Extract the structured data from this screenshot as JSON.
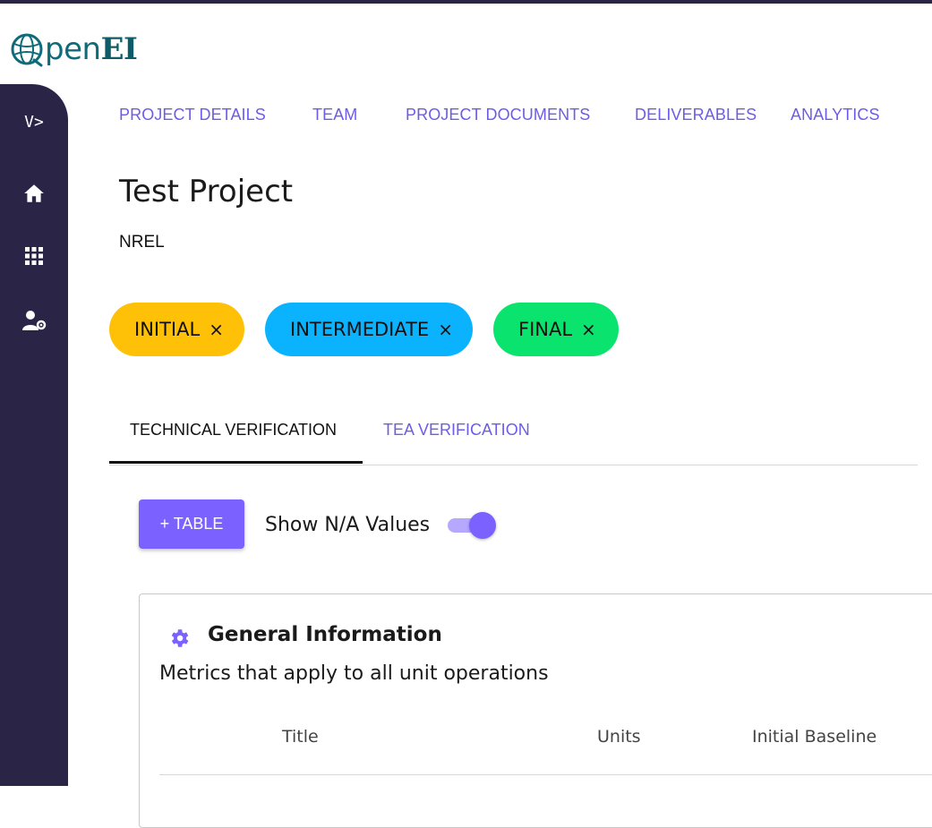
{
  "brand": {
    "logo_text_open": "pen",
    "logo_text_ei": "EI"
  },
  "nav": {
    "items": [
      {
        "label": "PROJECT DETAILS"
      },
      {
        "label": "TEAM"
      },
      {
        "label": "PROJECT DOCUMENTS"
      },
      {
        "label": "DELIVERABLES"
      },
      {
        "label": "ANALYTICS"
      }
    ]
  },
  "sidebar": {
    "toggle_label": "V>",
    "icons": [
      "home-icon",
      "apps-grid-icon",
      "user-settings-icon"
    ]
  },
  "project": {
    "title": "Test Project",
    "organization": "NREL"
  },
  "stages": {
    "items": [
      {
        "label": "INITIAL",
        "remove": "×",
        "color": "#ffc107"
      },
      {
        "label": "INTERMEDIATE",
        "remove": "×",
        "color": "#0bb3ff"
      },
      {
        "label": "FINAL",
        "remove": "×",
        "color": "#0ae36d"
      }
    ]
  },
  "tabs": {
    "items": [
      {
        "label": "TECHNICAL VERIFICATION",
        "active": true
      },
      {
        "label": "TEA VERIFICATION",
        "active": false
      }
    ]
  },
  "toolbar": {
    "add_table_label": "+ TABLE",
    "show_na_label": "Show N/A Values",
    "show_na_on": true
  },
  "card": {
    "title": "General Information",
    "subtitle": "Metrics that apply to all unit operations",
    "icon": "gear-icon",
    "columns": [
      "Title",
      "Units",
      "Initial Baseline"
    ]
  },
  "colors": {
    "accent": "#7b61ff",
    "sidebar": "#2a2447",
    "link": "#6c5ce7",
    "brand": "#0f6b7a"
  }
}
